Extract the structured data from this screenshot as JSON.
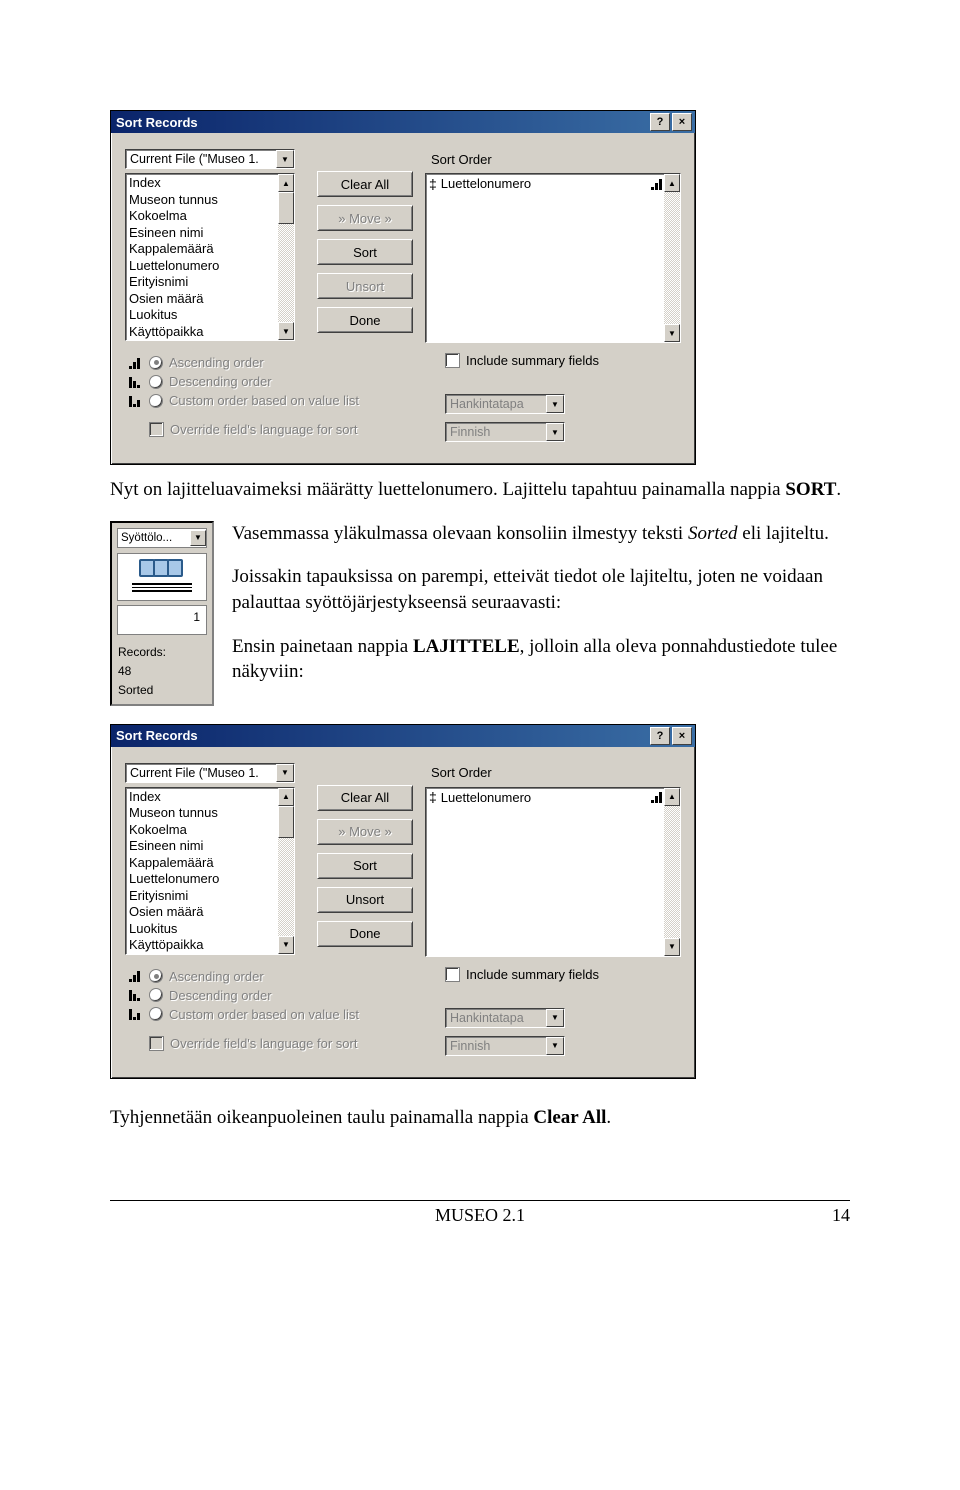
{
  "dialog1": {
    "title": "Sort Records",
    "source": "Current File (\"Museo 1.",
    "fields": [
      "Index",
      "Museon tunnus",
      "Kokoelma",
      "Esineen nimi",
      "Kappalemäärä",
      "Luettelonumero",
      "Erityisnimi",
      "Osien määrä",
      "Luokitus",
      "Käyttöpaikka"
    ],
    "buttons": {
      "clear": "Clear All",
      "move": "» Move »",
      "sort": "Sort",
      "unsort": "Unsort",
      "done": "Done"
    },
    "sortorder_label": "Sort Order",
    "sort_items": [
      "Luettelonumero"
    ],
    "include": "Include summary fields",
    "asc": "Ascending order",
    "desc": "Descending order",
    "cust": "Custom order based on value list",
    "override": "Override field's language for sort",
    "valuelist": "Hankintatapa",
    "language": "Finnish",
    "unsort_disabled": true
  },
  "dialog2": {
    "unsort_disabled": false
  },
  "text": {
    "p1a": "Nyt on lajitteluavaimeksi määrätty luettelonumero. Lajittelu tapahtuu painamalla nappia ",
    "p1b": "SORT",
    "p1c": ".",
    "p2a": "Vasemmassa yläkulmassa olevaan konsoliin ilmestyy teksti ",
    "p2b": "Sorted",
    "p2c": " eli lajiteltu.",
    "p3": "Joissakin tapauksissa on parempi, etteivät tiedot ole lajiteltu, joten ne voidaan palauttaa syöttöjärjestykseensä seuraavasti:",
    "p4a": "Ensin painetaan nappia ",
    "p4b": "LAJITTELE",
    "p4c": ", jolloin alla oleva ponnahdustiedote tulee näkyviin:",
    "p5a": "Tyhjennetään oikeanpuoleinen taulu painamalla nappia ",
    "p5b": "Clear All",
    "p5c": "."
  },
  "sidepanel": {
    "combo": "Syöttölo...",
    "page": "1",
    "records_label": "Records:",
    "records": "48",
    "status": "Sorted"
  },
  "footer": {
    "center": "MUSEO 2.1",
    "right": "14"
  }
}
